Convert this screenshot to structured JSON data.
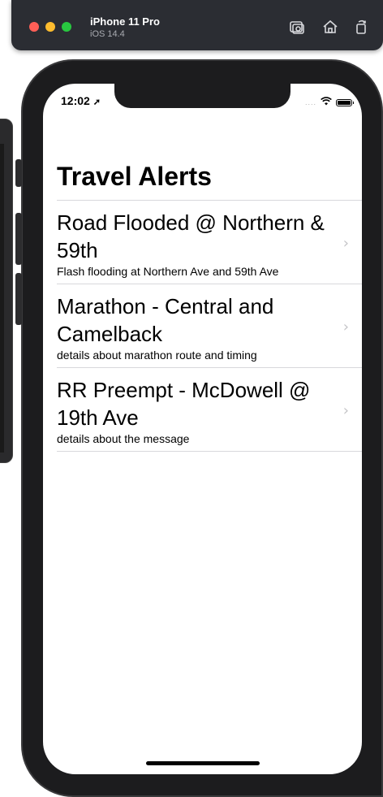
{
  "simulator": {
    "device_name": "iPhone 11 Pro",
    "os_version": "iOS 14.4",
    "buttons": [
      "screenshot-icon",
      "home-icon",
      "rotate-icon"
    ]
  },
  "status_bar": {
    "time": "12:02",
    "signal": "...."
  },
  "nav": {
    "title": "Travel Alerts"
  },
  "alerts": [
    {
      "title": "Road Flooded @ Northern & 59th",
      "subtitle": "Flash flooding at Northern Ave and 59th Ave"
    },
    {
      "title": "Marathon - Central and Camelback",
      "subtitle": "details about marathon route and timing"
    },
    {
      "title": "RR Preempt - McDowell @ 19th Ave",
      "subtitle": "details about the message"
    }
  ],
  "chevron": "›"
}
